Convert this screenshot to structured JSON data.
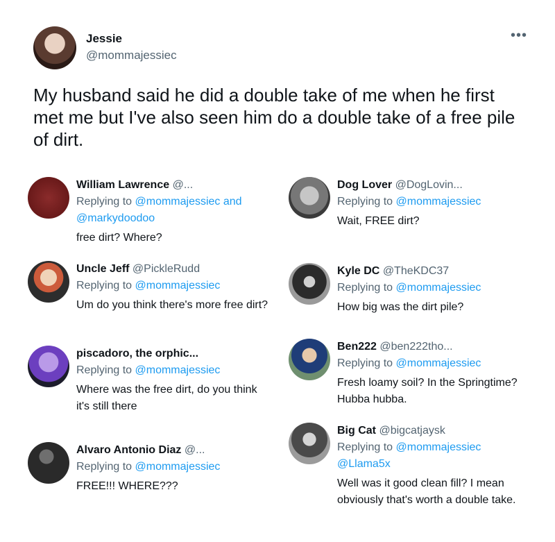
{
  "tweet": {
    "author": {
      "name": "Jessie",
      "handle": "@mommajessiec"
    },
    "more_icon": "more-horizontal-icon",
    "text": "My husband said he did a double take of me when he first met me but I've also seen him do a double take of a free pile of dirt."
  },
  "replies": [
    {
      "name": "William Lawrence",
      "handle": "@...",
      "replying_prefix": "Replying to",
      "mentions": "@mommajessiec and @markydoodoo",
      "text": "free dirt? Where?"
    },
    {
      "name": "Uncle Jeff",
      "handle": "@PickleRudd",
      "replying_prefix": "Replying to",
      "mentions": "@mommajessiec",
      "text": "Um do you think there's more free dirt?"
    },
    {
      "name": "piscadoro, the orphic...",
      "handle": "",
      "replying_prefix": "Replying to",
      "mentions": "@mommajessiec",
      "text": "Where was the free dirt, do you think it's still there"
    },
    {
      "name": "Alvaro Antonio Diaz",
      "handle": "@...",
      "replying_prefix": "Replying to",
      "mentions": "@mommajessiec",
      "text": "FREE!!! WHERE???"
    },
    {
      "name": "Dog Lover",
      "handle": "@DogLovin...",
      "replying_prefix": "Replying to",
      "mentions": "@mommajessiec",
      "text": "Wait, FREE dirt?"
    },
    {
      "name": "Kyle DC",
      "handle": "@TheKDC37",
      "replying_prefix": "Replying to",
      "mentions": "@mommajessiec",
      "text": "How big was the dirt pile?"
    },
    {
      "name": "Ben222",
      "handle": "@ben222tho...",
      "replying_prefix": "Replying to",
      "mentions": "@mommajessiec",
      "text": "Fresh loamy soil? In the Springtime? Hubba hubba."
    },
    {
      "name": "Big Cat",
      "handle": "@bigcatjaysk",
      "replying_prefix": "Replying to",
      "mentions": "@mommajessiec @Llama5x",
      "text": "Well was it good clean fill? I mean obviously that's worth a double take."
    }
  ],
  "colors": {
    "accent_link": "#1d9bf0",
    "secondary_text": "#536471",
    "primary_text": "#0f1419"
  }
}
